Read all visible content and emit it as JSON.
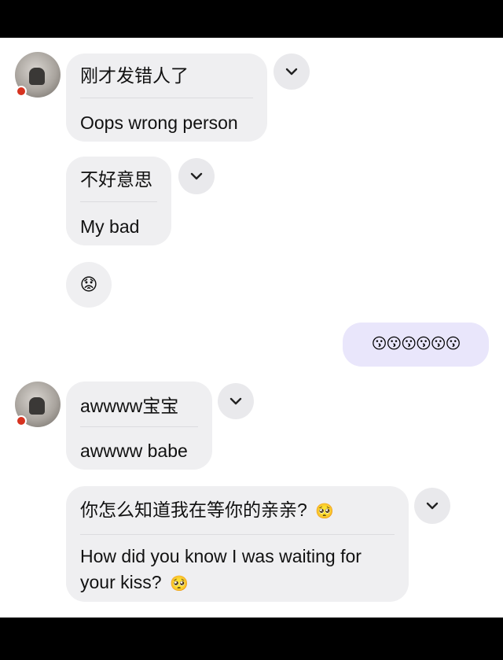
{
  "messages": {
    "m1": {
      "original": "刚才发错人了",
      "translation": "Oops wrong person"
    },
    "m2": {
      "original": "不好意思",
      "translation": "My bad"
    },
    "m3": {
      "emoji": "😟"
    },
    "m4": {
      "emoji": "😗😗😗😗😗😗"
    },
    "m5": {
      "original": "awwww宝宝",
      "translation": "awwww babe"
    },
    "m6": {
      "original": "你怎么知道我在等你的亲亲?",
      "original_emoji": "🥺",
      "translation_line1": "How did you know I was waiting for",
      "translation_line2": "your kiss?",
      "translation_emoji": "🥺"
    }
  },
  "icons": {
    "translate_toggle": "chevron-down-icon",
    "status_dot": "status-dot-icon"
  },
  "colors": {
    "incoming_bubble": "#efeff1",
    "outgoing_bubble": "#e9e6fb",
    "status_dot": "#d6321f"
  }
}
